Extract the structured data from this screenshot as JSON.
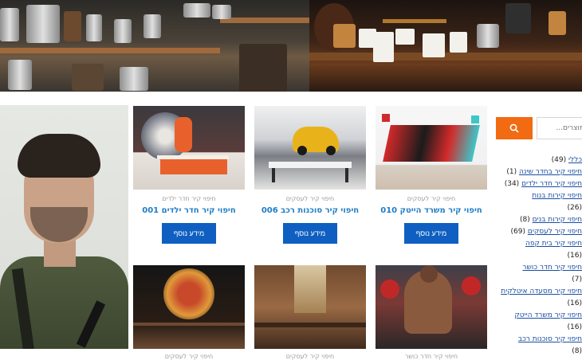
{
  "sidebar": {
    "search": {
      "placeholder": "מוצרים..."
    },
    "categories": [
      {
        "label": "כללי",
        "count": "(49)"
      },
      {
        "label": "חיפוי קיר בחדר שינה",
        "count": "(1)"
      },
      {
        "label": "חיפוי קיר חדר ילדים",
        "count": "(34)"
      },
      {
        "label": "חיפוי קירות בנות",
        "count": "(26)"
      },
      {
        "label": "חיפוי קירות בנים",
        "count": "(8)"
      },
      {
        "label": "חיפוי קיר לעסקים",
        "count": "(69)"
      },
      {
        "label": "חיפוי קיר בית קפה",
        "count": "(16)"
      },
      {
        "label": "חיפוי קיר חדר כושר",
        "count": "(7)"
      },
      {
        "label": "חיפוי קיר מסעדה איטלקית",
        "count": "(16)"
      },
      {
        "label": "חיפוי קיר משרד הייטק",
        "count": "(16)"
      },
      {
        "label": "חיפוי קיר סוכנות רכב",
        "count": "(8)"
      }
    ]
  },
  "products": [
    {
      "category": "חיפוי קיר חדר ילדים",
      "title": "חיפוי קיר חדר ילדים 001",
      "button": "מידע נוסף"
    },
    {
      "category": "חיפוי קיר לעסקים",
      "title": "חיפוי קיר סוכנות רכב 006",
      "button": "מידע נוסף"
    },
    {
      "category": "חיפוי קיר לעסקים",
      "title": "חיפוי קיר משרד הייטק 010",
      "button": "מידע נוסף"
    },
    {
      "category": "חיפוי קיר לעסקים"
    },
    {
      "category": "חיפוי קיר לעסקים"
    },
    {
      "category": "חיפוי קיר חדר כושר"
    }
  ],
  "colors": {
    "accent": "#f26a12",
    "button": "#0e5fc1",
    "title": "#1f7dc4",
    "link": "#1a4ea0"
  }
}
